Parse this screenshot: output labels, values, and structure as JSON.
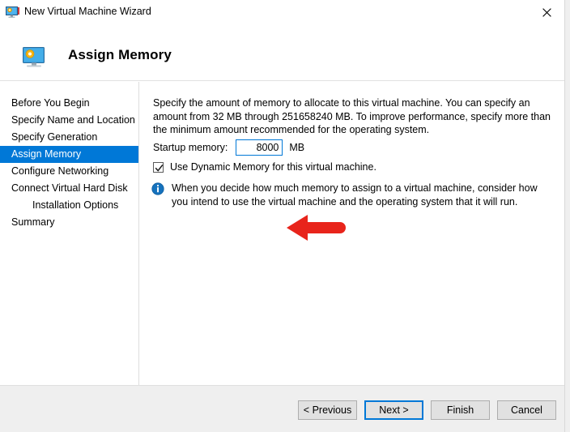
{
  "window": {
    "title": "New Virtual Machine Wizard",
    "icon": "virtual-machine-icon",
    "close_label": "✕"
  },
  "banner": {
    "title": "Assign Memory",
    "icon": "virtual-machine-icon"
  },
  "sidebar": {
    "items": [
      {
        "label": "Before You Begin",
        "selected": false,
        "indented": false
      },
      {
        "label": "Specify Name and Location",
        "selected": false,
        "indented": false
      },
      {
        "label": "Specify Generation",
        "selected": false,
        "indented": false
      },
      {
        "label": "Assign Memory",
        "selected": true,
        "indented": false
      },
      {
        "label": "Configure Networking",
        "selected": false,
        "indented": false
      },
      {
        "label": "Connect Virtual Hard Disk",
        "selected": false,
        "indented": false
      },
      {
        "label": "Installation Options",
        "selected": false,
        "indented": true
      },
      {
        "label": "Summary",
        "selected": false,
        "indented": false
      }
    ],
    "selected_color": "#0078d7"
  },
  "content": {
    "description": "Specify the amount of memory to allocate to this virtual machine. You can specify an amount from 32 MB through 251658240 MB. To improve performance, specify more than the minimum amount recommended for the operating system.",
    "memory_label": "Startup memory:",
    "memory_value": "8000",
    "memory_placeholder": "",
    "memory_unit": "MB",
    "dynamic_memory_label": "Use Dynamic Memory for this virtual machine.",
    "dynamic_memory_checked": true,
    "info_icon": "info-icon",
    "info_text": "When you decide how much memory to assign to a virtual machine, consider how you intend to use the virtual machine and the operating system that it will run."
  },
  "annotation": {
    "arrow": "left-pointing-red-arrow",
    "color": "#e8241b"
  },
  "footer": {
    "previous_label": "< Previous",
    "next_label": "Next >",
    "finish_label": "Finish",
    "cancel_label": "Cancel",
    "default_button": "Next >",
    "focus_color": "#0078d7"
  }
}
